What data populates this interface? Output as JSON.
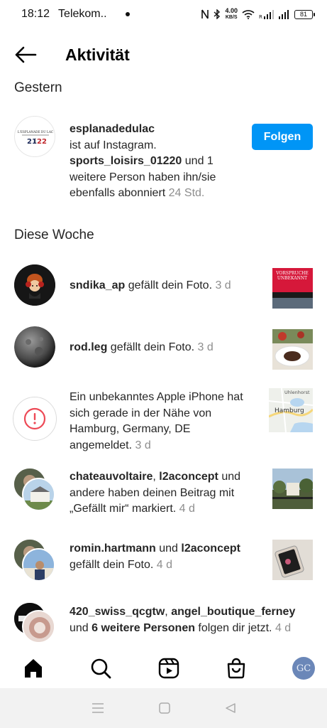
{
  "status": {
    "time": "18:12",
    "carrier": "Telekom..",
    "speed_value": "4.00",
    "speed_unit": "KB/S",
    "battery": "81"
  },
  "header": {
    "title": "Aktivität"
  },
  "sections": {
    "yesterday": "Gestern",
    "this_week": "Diese Woche"
  },
  "suggestion": {
    "username": "esplanadedulac",
    "line1": "ist auf Instagram.",
    "mention": "sports_loisirs_01220",
    "rest": " und 1 weitere Person haben ihn/sie ebenfalls abonniert ",
    "time": "24 Std.",
    "follow_label": "Folgen",
    "logo_top": "L'ESPLANADE DU LAC",
    "logo_left": "21",
    "logo_right": "22"
  },
  "items": [
    {
      "user": "sndika_ap",
      "text": " gefällt dein Foto. ",
      "time": "3 d"
    },
    {
      "user": "rod.leg",
      "text": " gefällt dein Foto. ",
      "time": "3 d"
    },
    {
      "text": "Ein unbekanntes Apple iPhone hat sich gerade in der Nähe von Hamburg, Germany, DE angemeldet. ",
      "time": "3 d",
      "map_label_top": "Uhlenhorst",
      "map_label_city": "Hamburg"
    },
    {
      "user": "chateauvoltaire",
      "sep": ", ",
      "user2": "l2aconcept",
      "text": " und andere haben deinen Beitrag mit „Gefällt mir“ markiert. ",
      "time": "4 d"
    },
    {
      "user": "romin.hartmann",
      "sep": " und ",
      "user2": "l2aconcept",
      "text": " gefällt dein Foto. ",
      "time": "4 d"
    },
    {
      "user": "420_swiss_qcgtw",
      "sep": ", ",
      "user2": "angel_boutique_ferney",
      "mid": " und ",
      "bold3": "6 weitere Personen",
      "text": " folgen dir jetzt. ",
      "time": "4 d"
    }
  ],
  "thumb1": {
    "line1": "VORSPRUCHE",
    "line2": "UNBEKANNT"
  },
  "profile_avatar": "GC",
  "icons": {
    "back": "arrow-left-icon",
    "home": "home-icon",
    "search": "search-icon",
    "reels": "reels-icon",
    "shop": "shop-icon"
  }
}
